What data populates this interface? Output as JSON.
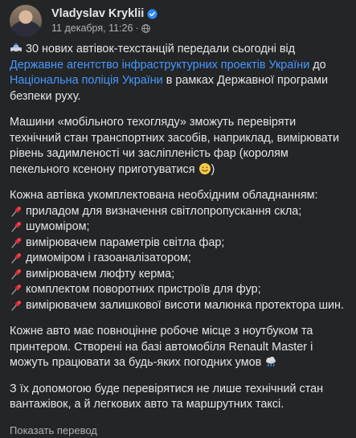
{
  "author": {
    "name": "Vladyslav Kryklii",
    "date": "11 декабря, 11:26",
    "separator": "·"
  },
  "icons": {
    "avatar": "profile-photo",
    "verified": "verified-badge-icon",
    "privacy": "globe-icon",
    "bullet": "pushpin-icon",
    "car": "police-car-icon",
    "smile": "smiling-face-icon",
    "weather": "rain-cloud-icon"
  },
  "post": {
    "p1": {
      "a": "30 нових автівок-техстанцій передали сьогодні від ",
      "link1": "Державне агентство інфраструктурних проектів України",
      "b": " до ",
      "link2": "Національна поліція України",
      "c": " в рамках Державної програми безпеки руху."
    },
    "p2": "Машини «мобільного техогляду» зможуть перевіряти технічний стан транспортних засобів, наприклад, вимірювати рівень задимленості чи засліпленість фар (королям пекельного ксенону приготуватися",
    "p2_end": ")",
    "p3_intro": "Кожна автівка укомплектована необхідним обладнанням:",
    "p3_items": [
      "приладом для визначення світлопропускання скла;",
      "шумоміром;",
      "вимірювачем параметрів світла фар;",
      "димоміром і газоаналізатором;",
      "вимірювачем люфту керма;",
      "комплектом поворотних пристроїв для фур;",
      "вимірювачем залишкової висоти малюнка протектора шин."
    ],
    "p4": "Кожне авто має повноцінне робоче місце з ноутбуком та принтером. Створені на базі автомобіля Renault Master і можуть працювати за будь-яких погодних умов",
    "p5": "З їх допомогою буде перевірятися не лише технічний стан вантажівок, а й легкових авто та маршрутних таксі."
  },
  "see_translation": "Показать перевод"
}
